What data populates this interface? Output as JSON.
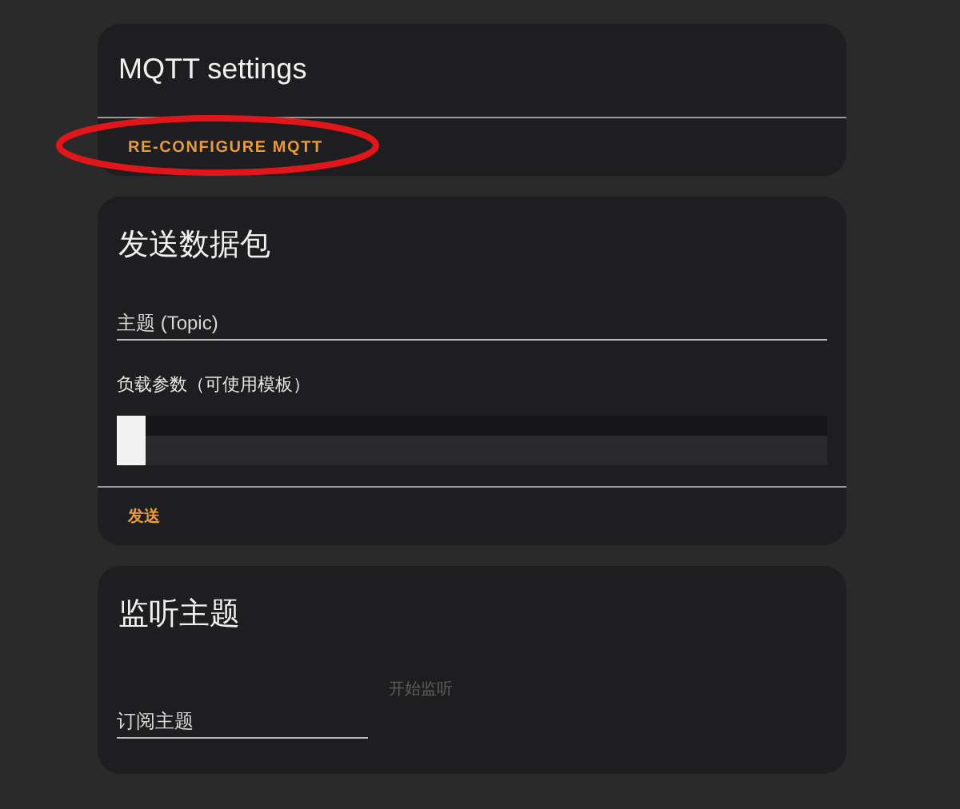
{
  "cards": [
    {
      "kind": "settings",
      "title": "MQTT settings",
      "action": {
        "label": "RE-CONFIGURE MQTT",
        "highlighted": true
      }
    },
    {
      "kind": "publish",
      "title": "发送数据包",
      "topic_field": {
        "placeholder": "主题 (Topic)"
      },
      "payload_label": "负载参数（可使用模板）",
      "action": {
        "label": "发送",
        "disabled": false
      }
    },
    {
      "kind": "listen",
      "title": "监听主题",
      "topic_field": {
        "placeholder": "订阅主题"
      },
      "action": {
        "label": "开始监听",
        "disabled": true
      }
    }
  ]
}
